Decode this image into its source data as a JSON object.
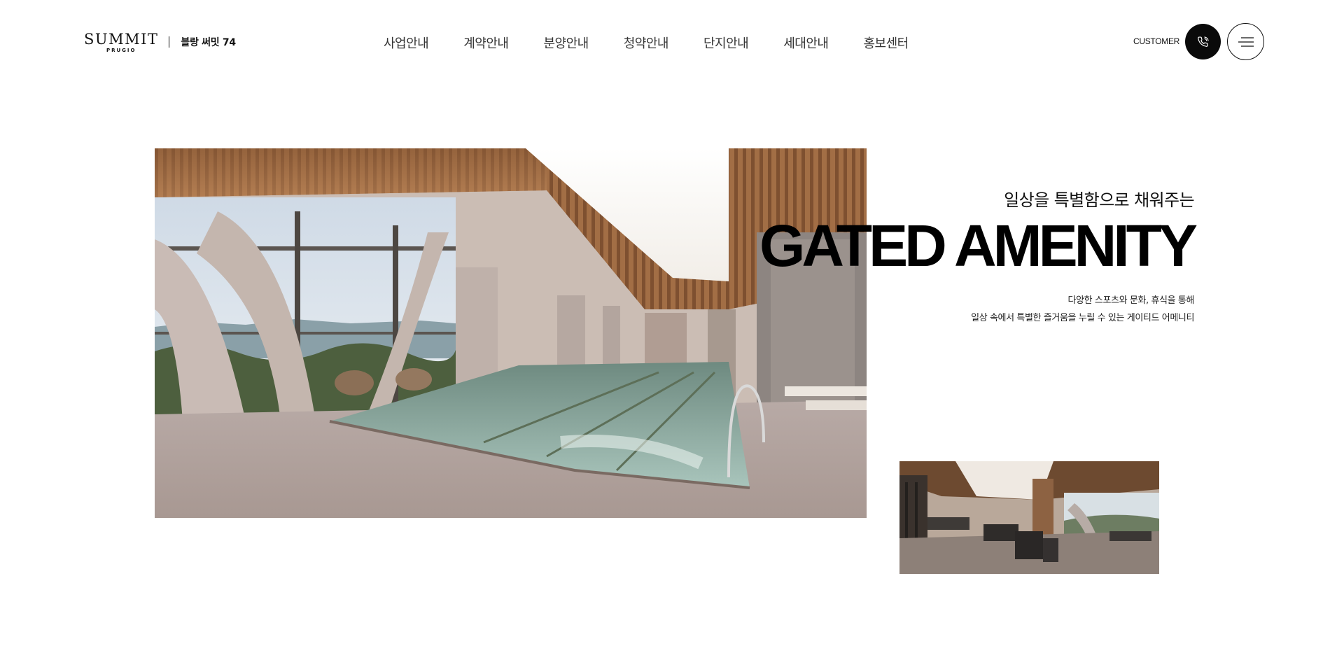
{
  "header": {
    "logo_main": "SUMMIT",
    "logo_sub": "PRUGIO",
    "site_name": "블랑 써밋 74",
    "nav": [
      "사업안내",
      "계약안내",
      "분양안내",
      "청약안내",
      "단지안내",
      "세대안내",
      "홍보센터"
    ],
    "customer_label": "CUSTOMER",
    "phone_icon": "phone-icon",
    "menu_icon": "hamburger-menu-icon"
  },
  "hero": {
    "subtitle": "일상을 특별함으로 채워주는",
    "title": "GATED AMENITY",
    "description": [
      "다양한 스포츠와 문화, 휴식을 통해",
      "일상 속에서 특별한 즐거움을 누릴 수 있는 게이티드 어메니티"
    ]
  },
  "colors": {
    "brand_black": "#000000",
    "background": "#ffffff"
  }
}
